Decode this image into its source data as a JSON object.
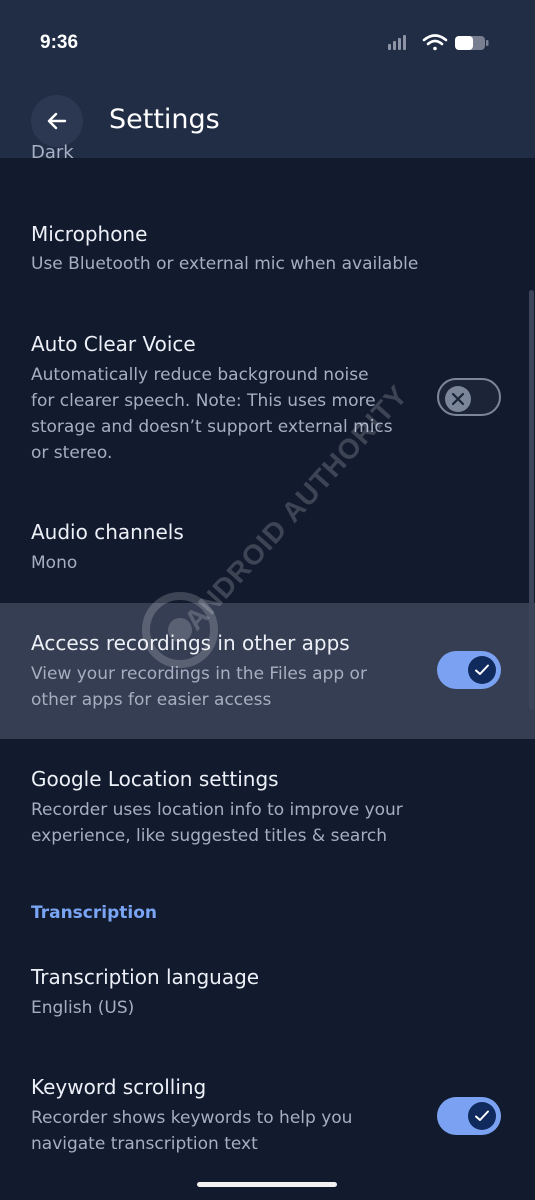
{
  "status_bar": {
    "time": "9:36"
  },
  "app_bar": {
    "title": "Settings",
    "back_icon": "arrow-left-icon"
  },
  "list": {
    "cut_off_value": "Dark",
    "items": [
      {
        "title": "Microphone",
        "subtitle": [
          "Use Bluetooth or external mic when available"
        ]
      },
      {
        "title": "Auto Clear Voice",
        "subtitle": [
          "Automatically reduce background noise",
          "for clearer speech. Note: This uses more",
          "storage and doesn’t support external mics",
          "or stereo."
        ],
        "toggle": false
      },
      {
        "title": "Audio channels",
        "subtitle": [
          "Mono"
        ]
      },
      {
        "title": "Access recordings in other apps",
        "subtitle": [
          "View your recordings in the Files app or",
          "other apps for easier access"
        ],
        "toggle": true
      },
      {
        "title": "Google Location settings",
        "subtitle": [
          "Recorder uses location info to improve your",
          "experience, like suggested titles & search"
        ]
      }
    ],
    "section_header": "Transcription",
    "transcription_items": [
      {
        "title": "Transcription language",
        "subtitle": [
          "English (US)"
        ]
      },
      {
        "title": "Keyword scrolling",
        "subtitle": [
          "Recorder shows keywords to help you",
          "navigate transcription text"
        ],
        "toggle": true
      }
    ]
  },
  "watermark": "ANDROID AUTHORITY",
  "colors": {
    "background": "#121a2e",
    "app_bar": "#212c45",
    "accent": "#7aa5f5",
    "toggle_on": "#7aa1f2",
    "highlight_row": "#363e53"
  }
}
